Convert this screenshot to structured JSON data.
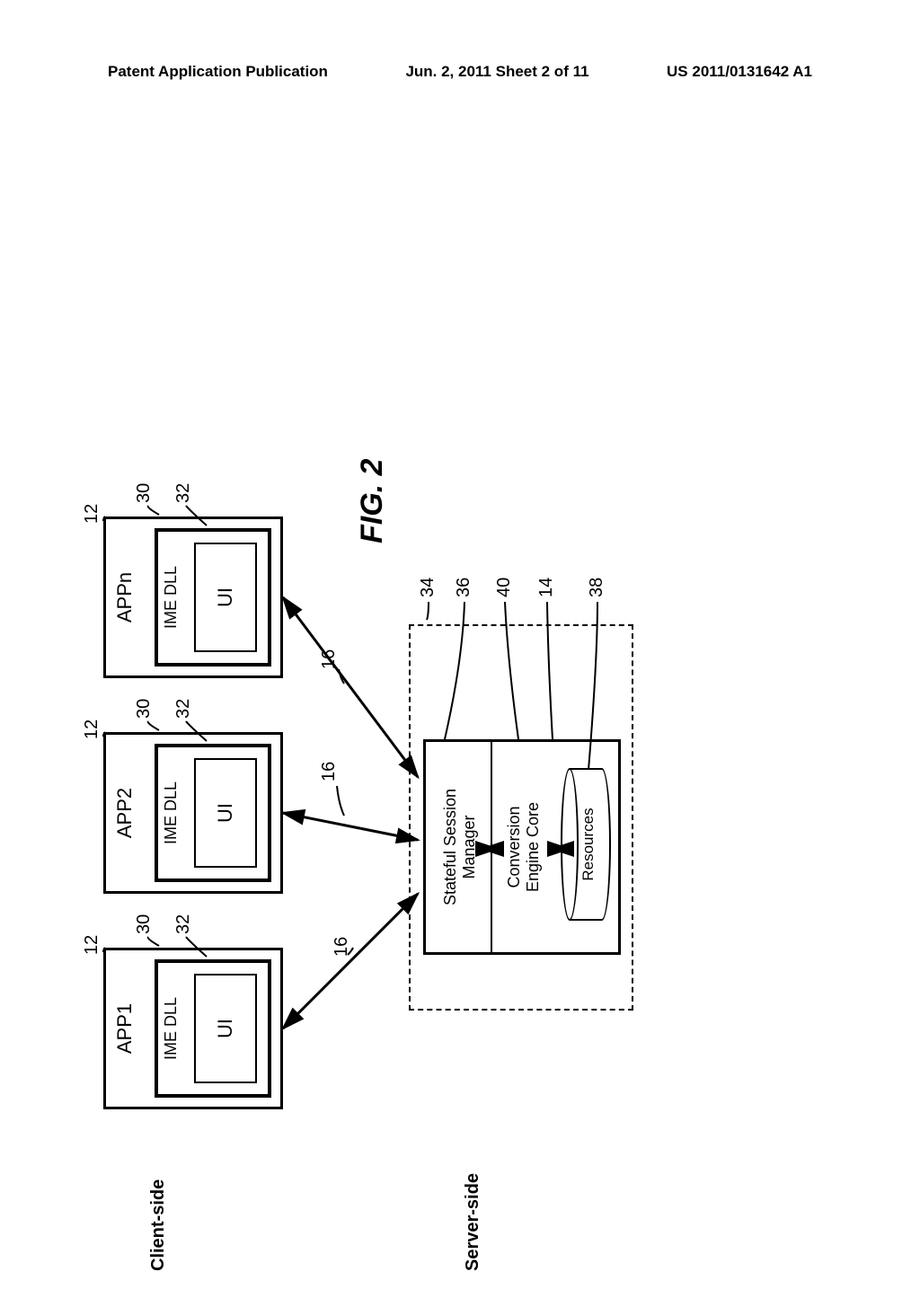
{
  "header": {
    "left": "Patent Application Publication",
    "center": "Jun. 2, 2011  Sheet 2 of 11",
    "right": "US 2011/0131642 A1"
  },
  "diagram": {
    "client_side": "Client-side",
    "server_side": "Server-side",
    "apps": [
      {
        "title": "APP1",
        "dll": "IME DLL",
        "ui": "UI"
      },
      {
        "title": "APP2",
        "dll": "IME DLL",
        "ui": "UI"
      },
      {
        "title": "APPn",
        "dll": "IME DLL",
        "ui": "UI"
      }
    ],
    "server": {
      "ssm_l1": "Stateful Session",
      "ssm_l2": "Manager",
      "cec_l1": "Conversion",
      "cec_l2": "Engine Core",
      "resources": "Resources"
    },
    "refs": {
      "r12": "12",
      "r30": "30",
      "r32": "32",
      "r16": "16",
      "r34": "34",
      "r36": "36",
      "r40": "40",
      "r14": "14",
      "r38": "38"
    },
    "fig": "FIG. 2"
  }
}
